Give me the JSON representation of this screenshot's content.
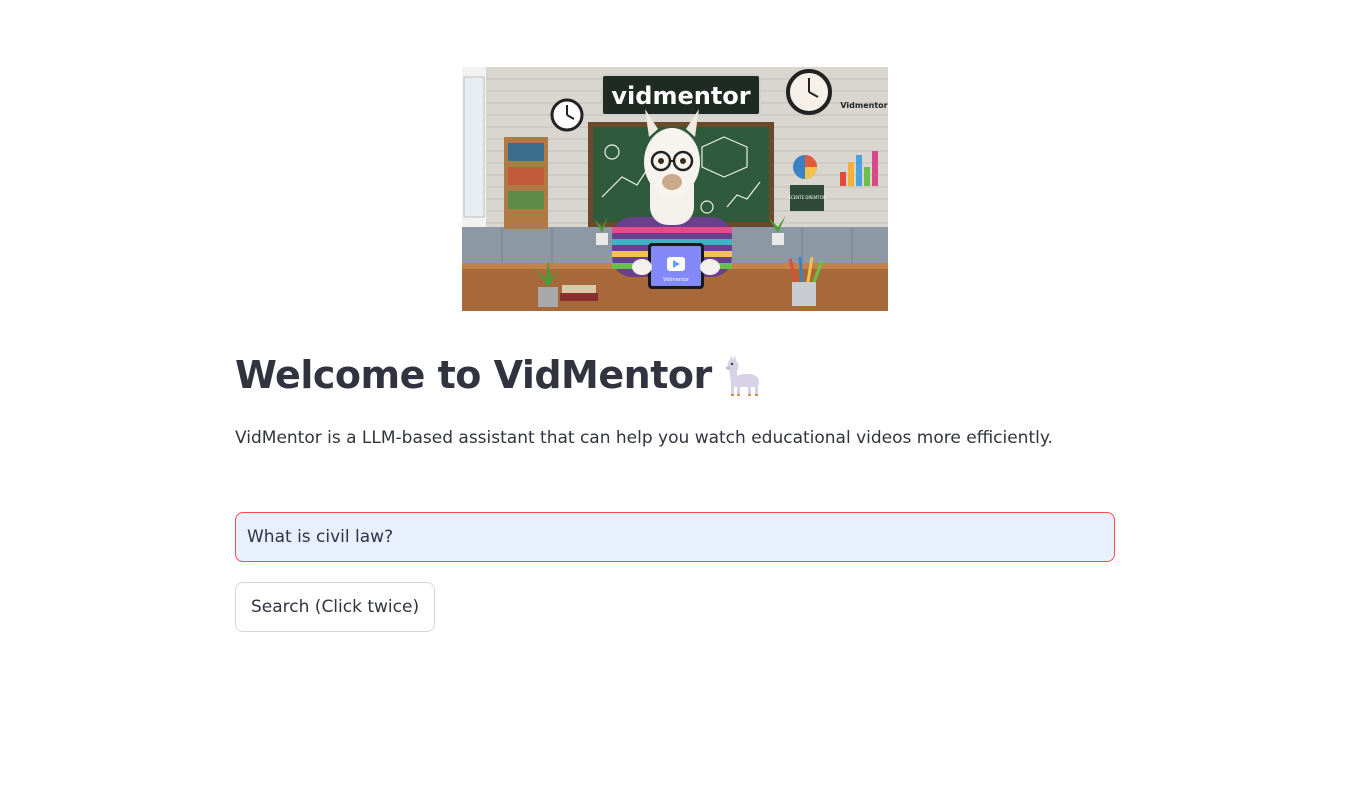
{
  "banner": {
    "logo_text": "vidmentor",
    "corner_text": "Vidmentor",
    "tablet_text": "Vidmentor",
    "poster_text": "ECENTE DREMTOR"
  },
  "header": {
    "title": "Welcome to VidMentor",
    "title_icon": "llama-icon"
  },
  "main": {
    "description": "VidMentor is a LLM-based assistant that can help you watch educational videos more efficiently.",
    "query_input": {
      "value": "What is civil law?",
      "placeholder": ""
    },
    "search_button_label": "Search (Click twice)"
  },
  "colors": {
    "accent_border": "#ff4b4b",
    "input_background": "#e8f0fe",
    "text": "#31333f"
  }
}
